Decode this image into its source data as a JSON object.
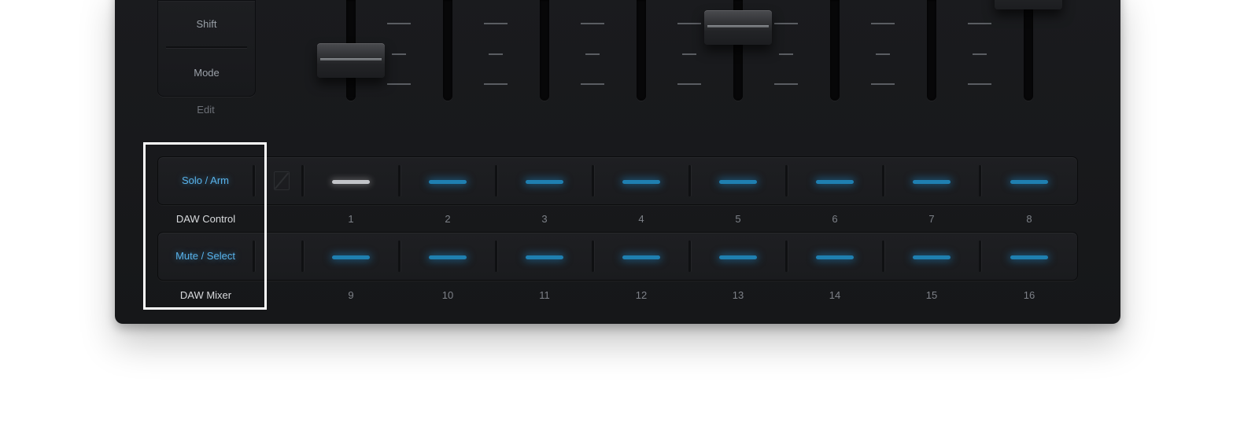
{
  "controls": {
    "shift_label": "Shift",
    "mode_label": "Mode",
    "edit_label": "Edit"
  },
  "rows": [
    {
      "function_label": "Solo / Arm",
      "row_label": "DAW Control",
      "pads": [
        "1",
        "2",
        "3",
        "4",
        "5",
        "6",
        "7",
        "8"
      ]
    },
    {
      "function_label": "Mute / Select",
      "row_label": "DAW Mixer",
      "pads": [
        "9",
        "10",
        "11",
        "12",
        "13",
        "14",
        "15",
        "16"
      ]
    }
  ],
  "colors": {
    "accent_blue": "#58b2ea",
    "led_blue": "#1f7fb0",
    "led_white": "#c2c4c8",
    "highlight": "#ffffff",
    "device_body": "#18191c"
  },
  "leds": {
    "row1": [
      "white",
      "blue",
      "blue",
      "blue",
      "blue",
      "blue",
      "blue",
      "blue"
    ],
    "row2": [
      "blue",
      "blue",
      "blue",
      "blue",
      "blue",
      "blue",
      "blue",
      "blue"
    ]
  },
  "icons": {
    "mode_indicator": "slash-box-icon"
  }
}
